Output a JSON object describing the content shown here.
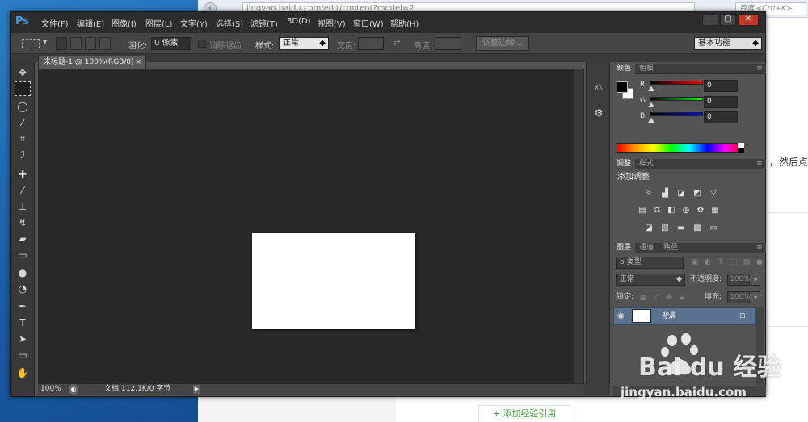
{
  "browser": {
    "url": "jingyan.baidu.com/edit/content?model=2",
    "search_placeholder": "百度 <Ctrl+K>",
    "side_text": "，然后点",
    "add_ref_label": "+ 添加经验引用"
  },
  "ps": {
    "logo": "Ps",
    "menus": [
      "文件(F)",
      "编辑(E)",
      "图像(I)",
      "图层(L)",
      "文字(Y)",
      "选择(S)",
      "滤镜(T)",
      "3D(D)",
      "视图(V)",
      "窗口(W)",
      "帮助(H)"
    ],
    "window_buttons": {
      "minimize": "—",
      "maximize": "▢",
      "close": "✕"
    },
    "options": {
      "feather_label": "羽化:",
      "feather_value": "0 像素",
      "antialias_label": "消除锯齿",
      "style_label": "样式:",
      "style_value": "正常",
      "width_label": "宽度:",
      "height_label": "高度:",
      "refine_edge_label": "调整边缘...",
      "workspace": "基本功能"
    },
    "document": {
      "tab_title": "未标题-1 @ 100%(RGB/8)",
      "tab_close": "×",
      "zoom": "100%",
      "doc_info": "文档:112.1K/0 字节",
      "canvas_color": "#ffffff"
    },
    "color_panel": {
      "tabs": [
        "颜色",
        "色板"
      ],
      "r_label": "R",
      "g_label": "G",
      "b_label": "B",
      "r_value": "0",
      "g_value": "0",
      "b_value": "0",
      "foreground": "#000000",
      "background": "#ffffff"
    },
    "adjust_panel": {
      "tabs": [
        "调整",
        "样式"
      ],
      "title": "添加调整"
    },
    "layers_panel": {
      "tabs": [
        "图层",
        "通道",
        "路径"
      ],
      "kind_filter": "ρ 类型",
      "blend_mode": "正常",
      "opacity_label": "不透明度:",
      "opacity_value": "100%",
      "lock_label": "锁定:",
      "fill_label": "填充:",
      "fill_value": "100%",
      "layer_name": "背景"
    }
  },
  "watermark": {
    "brand": "Bai du 经验",
    "url": "jingyan.baidu.com"
  }
}
